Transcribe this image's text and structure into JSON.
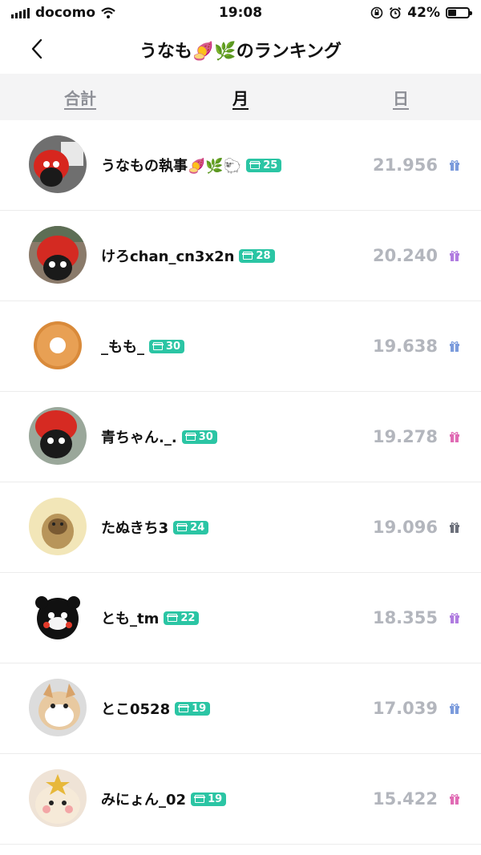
{
  "status": {
    "carrier": "docomo",
    "time": "19:08",
    "battery": "42%",
    "battery_level": 0.42
  },
  "nav": {
    "title": "うなも🍠🌿のランキング"
  },
  "tabs": [
    {
      "label": "合計",
      "active": false
    },
    {
      "label": "月",
      "active": true
    },
    {
      "label": "日",
      "active": false
    }
  ],
  "rows": [
    {
      "name": "うなもの執事🍠🌿🐑",
      "level": "25",
      "score": "21.956",
      "gift_color": "#7b9bdc"
    },
    {
      "name": "けろchan_cn3x2n",
      "level": "28",
      "score": "20.240",
      "gift_color": "#b07ce0"
    },
    {
      "name": "_もも_",
      "level": "30",
      "score": "19.638",
      "gift_color": "#7b9bdc"
    },
    {
      "name": "青ちゃん._.",
      "level": "30",
      "score": "19.278",
      "gift_color": "#e06bb4"
    },
    {
      "name": "たぬきち3",
      "level": "24",
      "score": "19.096",
      "gift_color": "#6b6f7a"
    },
    {
      "name": "とも_tm",
      "level": "22",
      "score": "18.355",
      "gift_color": "#b07ce0"
    },
    {
      "name": "とこ0528",
      "level": "19",
      "score": "17.039",
      "gift_color": "#7b9bdc"
    },
    {
      "name": "みにょん_02",
      "level": "19",
      "score": "15.422",
      "gift_color": "#e06bb4"
    }
  ]
}
